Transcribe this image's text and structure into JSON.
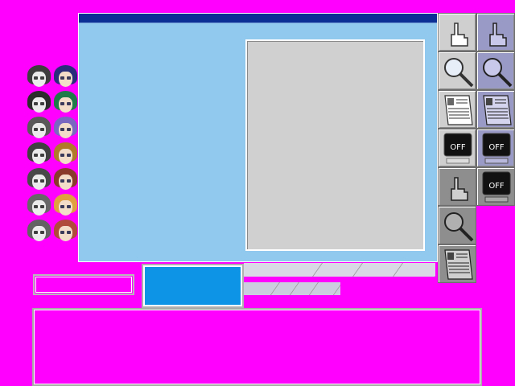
{
  "window": {
    "title": ""
  },
  "portraits": [
    {
      "hair": "#3a3a4a",
      "gray": true
    },
    {
      "hair": "#2a2e7a",
      "gray": false
    },
    {
      "hair": "#2a2a2a",
      "gray": true
    },
    {
      "hair": "#1f7a4a",
      "gray": false
    },
    {
      "hair": "#555555",
      "gray": true
    },
    {
      "hair": "#7a68c0",
      "gray": false
    },
    {
      "hair": "#4a3a3a",
      "gray": true
    },
    {
      "hair": "#b07a2a",
      "gray": false
    },
    {
      "hair": "#5a4040",
      "gray": true
    },
    {
      "hair": "#8a3a2a",
      "gray": false
    },
    {
      "hair": "#6a6060",
      "gray": true
    },
    {
      "hair": "#e0a040",
      "gray": false
    },
    {
      "hair": "#6a5a5a",
      "gray": true
    },
    {
      "hair": "#b04a3a",
      "gray": false
    }
  ],
  "icon_buttons": {
    "off_label": "OFF",
    "colors": {
      "normal": "#cfcfcf",
      "hover": "#9a9ac6",
      "pressed": "#8e8e8e",
      "screen": "#111111"
    }
  },
  "colors": {
    "background": "#ff00ff",
    "window": "#90c8ee",
    "title_bar": "#0b2f94",
    "preview": "#d0d0d0",
    "blue_button": "#0d94e6"
  }
}
